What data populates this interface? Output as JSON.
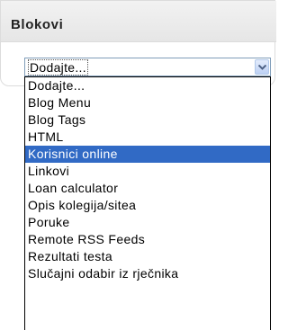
{
  "block": {
    "title": "Blokovi"
  },
  "select": {
    "value": "Dodajte...",
    "arrow_icon": "chevron-down-icon",
    "selected_index": 4,
    "options": [
      "Dodajte...",
      "Blog Menu",
      "Blog Tags",
      "HTML",
      "Korisnici online",
      "Linkovi",
      "Loan calculator",
      "Opis kolegija/sitea",
      "Poruke",
      "Remote RSS Feeds",
      "Rezultati testa",
      "Slučajni odabir iz rječnika"
    ]
  },
  "colors": {
    "highlight": "#316ac5",
    "field_border": "#7f9db9"
  }
}
